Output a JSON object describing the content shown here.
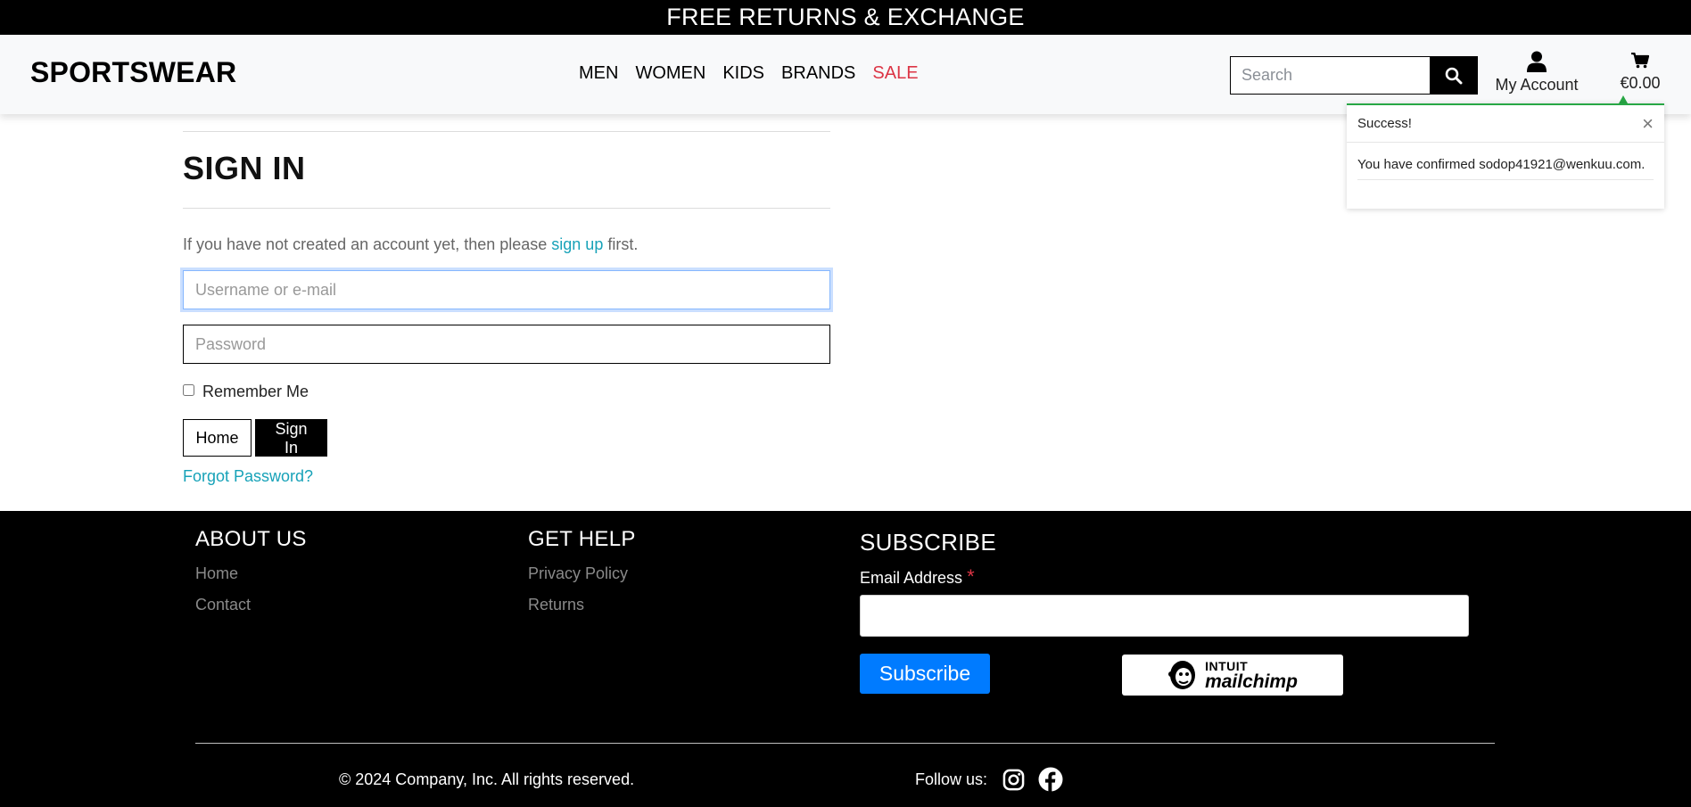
{
  "banner": {
    "text": "FREE RETURNS & EXCHANGE"
  },
  "header": {
    "logo": "SPORTSWEAR",
    "nav": [
      {
        "label": "MEN"
      },
      {
        "label": "WOMEN"
      },
      {
        "label": "KIDS"
      },
      {
        "label": "BRANDS"
      },
      {
        "label": "SALE"
      }
    ],
    "search": {
      "placeholder": "Search",
      "icon": "search-icon"
    },
    "account": {
      "label": "My Account",
      "icon": "user-icon"
    },
    "cart": {
      "label": "€0.00",
      "icon": "cart-icon"
    }
  },
  "toast": {
    "title": "Success!",
    "close": "×",
    "message": "You have confirmed sodop41921@wenkuu.com."
  },
  "signin": {
    "title": "SIGN IN",
    "intro_before": "If you have not created an account yet, then please ",
    "intro_link": "sign up",
    "intro_after": " first.",
    "username_placeholder": "Username or e-mail",
    "password_placeholder": "Password",
    "remember_label": "Remember Me",
    "home_button": "Home",
    "signin_button": "Sign In",
    "forgot_link": "Forgot Password?"
  },
  "footer": {
    "about": {
      "heading": "ABOUT US",
      "links": [
        "Home",
        "Contact"
      ]
    },
    "help": {
      "heading": "GET HELP",
      "links": [
        "Privacy Policy",
        "Returns"
      ]
    },
    "subscribe": {
      "heading": "SUBSCRIBE",
      "email_label": "Email Address",
      "required_mark": "*",
      "button": "Subscribe",
      "badge_intuit": "INTUIT",
      "badge_mailchimp": "mailchimp"
    },
    "copyright": "© 2024 Company, Inc. All rights reserved.",
    "follow_label": "Follow us:"
  },
  "colors": {
    "accent_link": "#17a2b8",
    "sale": "#dc3545",
    "success": "#28a745",
    "subscribe": "#007bff"
  }
}
